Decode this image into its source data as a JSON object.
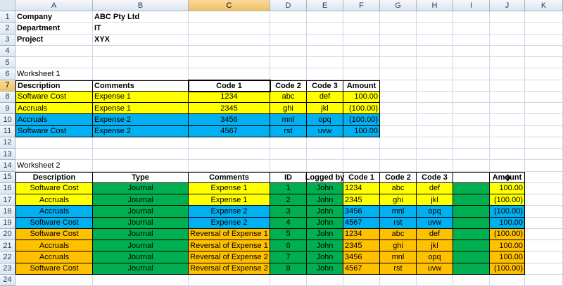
{
  "columns": [
    "A",
    "B",
    "C",
    "D",
    "E",
    "F",
    "G",
    "H",
    "I",
    "J",
    "K"
  ],
  "selected_column": "C",
  "selected_row": 7,
  "rows": [
    1,
    2,
    3,
    4,
    5,
    6,
    7,
    8,
    9,
    10,
    11,
    12,
    13,
    14,
    15,
    16,
    17,
    18,
    19,
    20,
    21,
    22,
    23,
    24
  ],
  "colors": {
    "yellow": "#ffff00",
    "blue": "#00b0f0",
    "green": "#00b050",
    "orange": "#ffc000"
  },
  "header_info": [
    {
      "label": "Company",
      "value": "ABC Pty Ltd"
    },
    {
      "label": "Department",
      "value": "IT"
    },
    {
      "label": "Project",
      "value": "XYX"
    }
  ],
  "worksheet1": {
    "title": "Worksheet 1",
    "headers": [
      "Description",
      "Comments",
      "Code 1",
      "Code 2",
      "Code 3",
      "Amount"
    ],
    "rows": [
      {
        "fill": "yellow",
        "cells": [
          "Software Cost",
          "Expense 1",
          "1234",
          "abc",
          "def",
          "100.00"
        ]
      },
      {
        "fill": "yellow",
        "cells": [
          "Accruals",
          "Expense 1",
          "2345",
          "ghi",
          "jkl",
          "(100.00)"
        ]
      },
      {
        "fill": "blue",
        "cells": [
          "Accruals",
          "Expense 2",
          "3456",
          "mnl",
          "opq",
          "(100.00)"
        ]
      },
      {
        "fill": "blue",
        "cells": [
          "Software Cost",
          "Expense 2",
          "4567",
          "rst",
          "uvw",
          "100.00"
        ]
      }
    ]
  },
  "worksheet2": {
    "title": "Worksheet 2",
    "headers": [
      "Description",
      "Type",
      "Comments",
      "ID",
      "Logged by",
      "Code 1",
      "Code 2",
      "Code 3",
      "",
      "Amount"
    ],
    "rows": [
      {
        "fills": [
          "yellow",
          "green",
          "yellow",
          "green",
          "green",
          "yellow",
          "yellow",
          "yellow",
          "green",
          "yellow"
        ],
        "cells": [
          "Software Cost",
          "Journal",
          "Expense 1",
          "1",
          "John",
          "1234",
          "abc",
          "def",
          "",
          "100.00"
        ]
      },
      {
        "fills": [
          "yellow",
          "green",
          "yellow",
          "green",
          "green",
          "yellow",
          "yellow",
          "yellow",
          "green",
          "yellow"
        ],
        "cells": [
          "Accruals",
          "Journal",
          "Expense 1",
          "2",
          "John",
          "2345",
          "ghi",
          "jkl",
          "",
          "(100.00)"
        ]
      },
      {
        "fills": [
          "blue",
          "green",
          "blue",
          "green",
          "green",
          "blue",
          "blue",
          "blue",
          "green",
          "blue"
        ],
        "cells": [
          "Accruals",
          "Journal",
          "Expense 2",
          "3",
          "John",
          "3456",
          "mnl",
          "opq",
          "",
          "(100.00)"
        ]
      },
      {
        "fills": [
          "blue",
          "green",
          "blue",
          "green",
          "green",
          "blue",
          "blue",
          "blue",
          "green",
          "blue"
        ],
        "cells": [
          "Software Cost",
          "Journal",
          "Expense 2",
          "4",
          "John",
          "4567",
          "rst",
          "uvw",
          "",
          "100.00"
        ]
      },
      {
        "fills": [
          "orange",
          "green",
          "orange",
          "green",
          "green",
          "orange",
          "orange",
          "orange",
          "green",
          "orange"
        ],
        "cells": [
          "Software Cost",
          "Journal",
          "Reversal of Expense 1",
          "5",
          "John",
          "1234",
          "abc",
          "def",
          "",
          "(100.00)"
        ]
      },
      {
        "fills": [
          "orange",
          "green",
          "orange",
          "green",
          "green",
          "orange",
          "orange",
          "orange",
          "green",
          "orange"
        ],
        "cells": [
          "Accruals",
          "Journal",
          "Reversal of Expense 1",
          "6",
          "John",
          "2345",
          "ghi",
          "jkl",
          "",
          "100.00"
        ]
      },
      {
        "fills": [
          "orange",
          "green",
          "orange",
          "green",
          "green",
          "orange",
          "orange",
          "orange",
          "green",
          "orange"
        ],
        "cells": [
          "Accruals",
          "Journal",
          "Reversal of Expense 2",
          "7",
          "John",
          "3456",
          "mnl",
          "opq",
          "",
          "100.00"
        ]
      },
      {
        "fills": [
          "orange",
          "green",
          "orange",
          "green",
          "green",
          "orange",
          "orange",
          "orange",
          "green",
          "orange"
        ],
        "cells": [
          "Software Cost",
          "Journal",
          "Reversal of Expense 2",
          "8",
          "John",
          "4567",
          "rst",
          "uvw",
          "",
          "(100.00)"
        ]
      }
    ]
  },
  "cursor_icon": "move-cursor-icon"
}
